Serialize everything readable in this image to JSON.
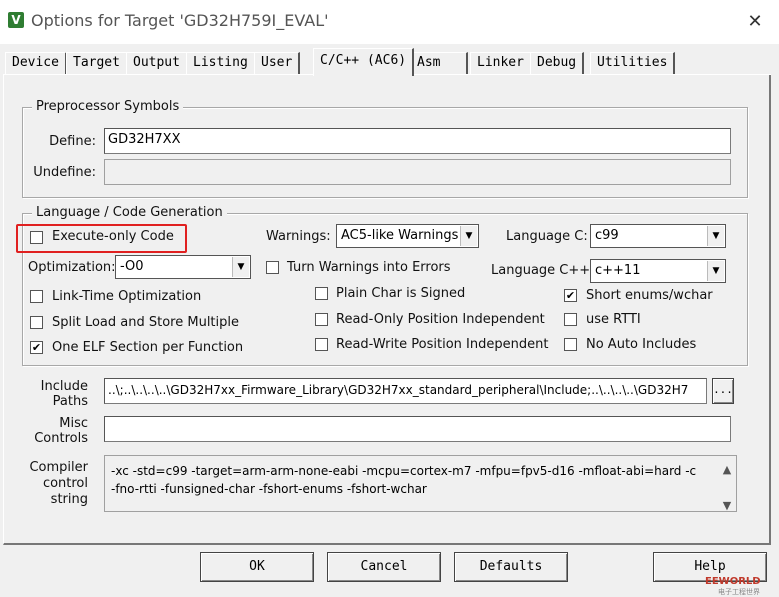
{
  "window": {
    "title": "Options for Target 'GD32H759I_EVAL'",
    "icon_letter": "V",
    "close_glyph": "✕"
  },
  "tabs": [
    {
      "label": "Device",
      "active": false
    },
    {
      "label": "Target",
      "active": false
    },
    {
      "label": "Output",
      "active": false
    },
    {
      "label": "Listing",
      "active": false
    },
    {
      "label": "User",
      "active": false
    },
    {
      "label": "C/C++ (AC6)",
      "active": true
    },
    {
      "label": "Asm",
      "active": false
    },
    {
      "label": "Linker",
      "active": false
    },
    {
      "label": "Debug",
      "active": false
    },
    {
      "label": "Utilities",
      "active": false
    }
  ],
  "preprocessor": {
    "legend": "Preprocessor Symbols",
    "define_label": "Define:",
    "define_value": "GD32H7XX",
    "undefine_label": "Undefine:",
    "undefine_value": ""
  },
  "language": {
    "legend": "Language / Code Generation",
    "execute_only": {
      "label": "Execute-only Code",
      "checked": false
    },
    "warnings_label": "Warnings:",
    "warnings_value": "AC5-like Warnings",
    "language_c_label": "Language C:",
    "language_c_value": "c99",
    "optimization_label": "Optimization:",
    "optimization_value": "-O0",
    "turn_warnings_errors": {
      "label": "Turn Warnings into Errors",
      "checked": false
    },
    "language_cpp_label": "Language C++:",
    "language_cpp_value": "c++11",
    "lto": {
      "label": "Link-Time Optimization",
      "checked": false
    },
    "plain_char": {
      "label": "Plain Char is Signed",
      "checked": false
    },
    "short_enums": {
      "label": "Short enums/wchar",
      "checked": true
    },
    "split_load": {
      "label": "Split Load and Store Multiple",
      "checked": false
    },
    "ro_pi": {
      "label": "Read-Only Position Independent",
      "checked": false
    },
    "rtti": {
      "label": "use RTTI",
      "checked": false
    },
    "one_elf": {
      "label": "One ELF Section per Function",
      "checked": true
    },
    "rw_pi": {
      "label": "Read-Write Position Independent",
      "checked": false
    },
    "no_auto_includes": {
      "label": "No Auto Includes",
      "checked": false
    }
  },
  "include": {
    "label_line1": "Include",
    "label_line2": "Paths",
    "value": "..\\;..\\..\\..\\..\\GD32H7xx_Firmware_Library\\GD32H7xx_standard_peripheral\\Include;..\\..\\..\\..\\GD32H7",
    "browse_label": "..."
  },
  "misc": {
    "label_line1": "Misc",
    "label_line2": "Controls",
    "value": ""
  },
  "compiler": {
    "label_line1": "Compiler",
    "label_line2": "control",
    "label_line3": "string",
    "line1": "-xc -std=c99 -target=arm-arm-none-eabi -mcpu=cortex-m7 -mfpu=fpv5-d16 -mfloat-abi=hard -c",
    "line2": "-fno-rtti -funsigned-char -fshort-enums -fshort-wchar"
  },
  "buttons": {
    "ok": "OK",
    "cancel": "Cancel",
    "defaults": "Defaults",
    "help": "Help"
  },
  "watermark": {
    "line1": "EEWORLD",
    "line2": "电子工程世界"
  },
  "colors": {
    "highlight": "#e02020",
    "dialog_bg": "#f0f0f0"
  }
}
